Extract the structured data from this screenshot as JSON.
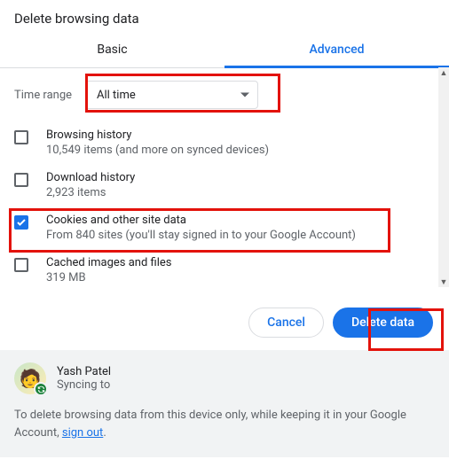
{
  "title": "Delete browsing data",
  "tabs": {
    "basic": "Basic",
    "advanced": "Advanced"
  },
  "range": {
    "label": "Time range",
    "value": "All time"
  },
  "items": [
    {
      "title": "Browsing history",
      "sub": "10,549 items (and more on synced devices)",
      "checked": false
    },
    {
      "title": "Download history",
      "sub": "2,923 items",
      "checked": false
    },
    {
      "title": "Cookies and other site data",
      "sub": "From 840 sites (you'll stay signed in to your Google Account)",
      "checked": true
    },
    {
      "title": "Cached images and files",
      "sub": "319 MB",
      "checked": false
    }
  ],
  "buttons": {
    "cancel": "Cancel",
    "confirm": "Delete data"
  },
  "account": {
    "name": "Yash Patel",
    "sync": "Syncing to",
    "msg_pre": "To delete browsing data from this device only, while keeping it in your Google Account, ",
    "sign_out": "sign out",
    "msg_post": "."
  }
}
